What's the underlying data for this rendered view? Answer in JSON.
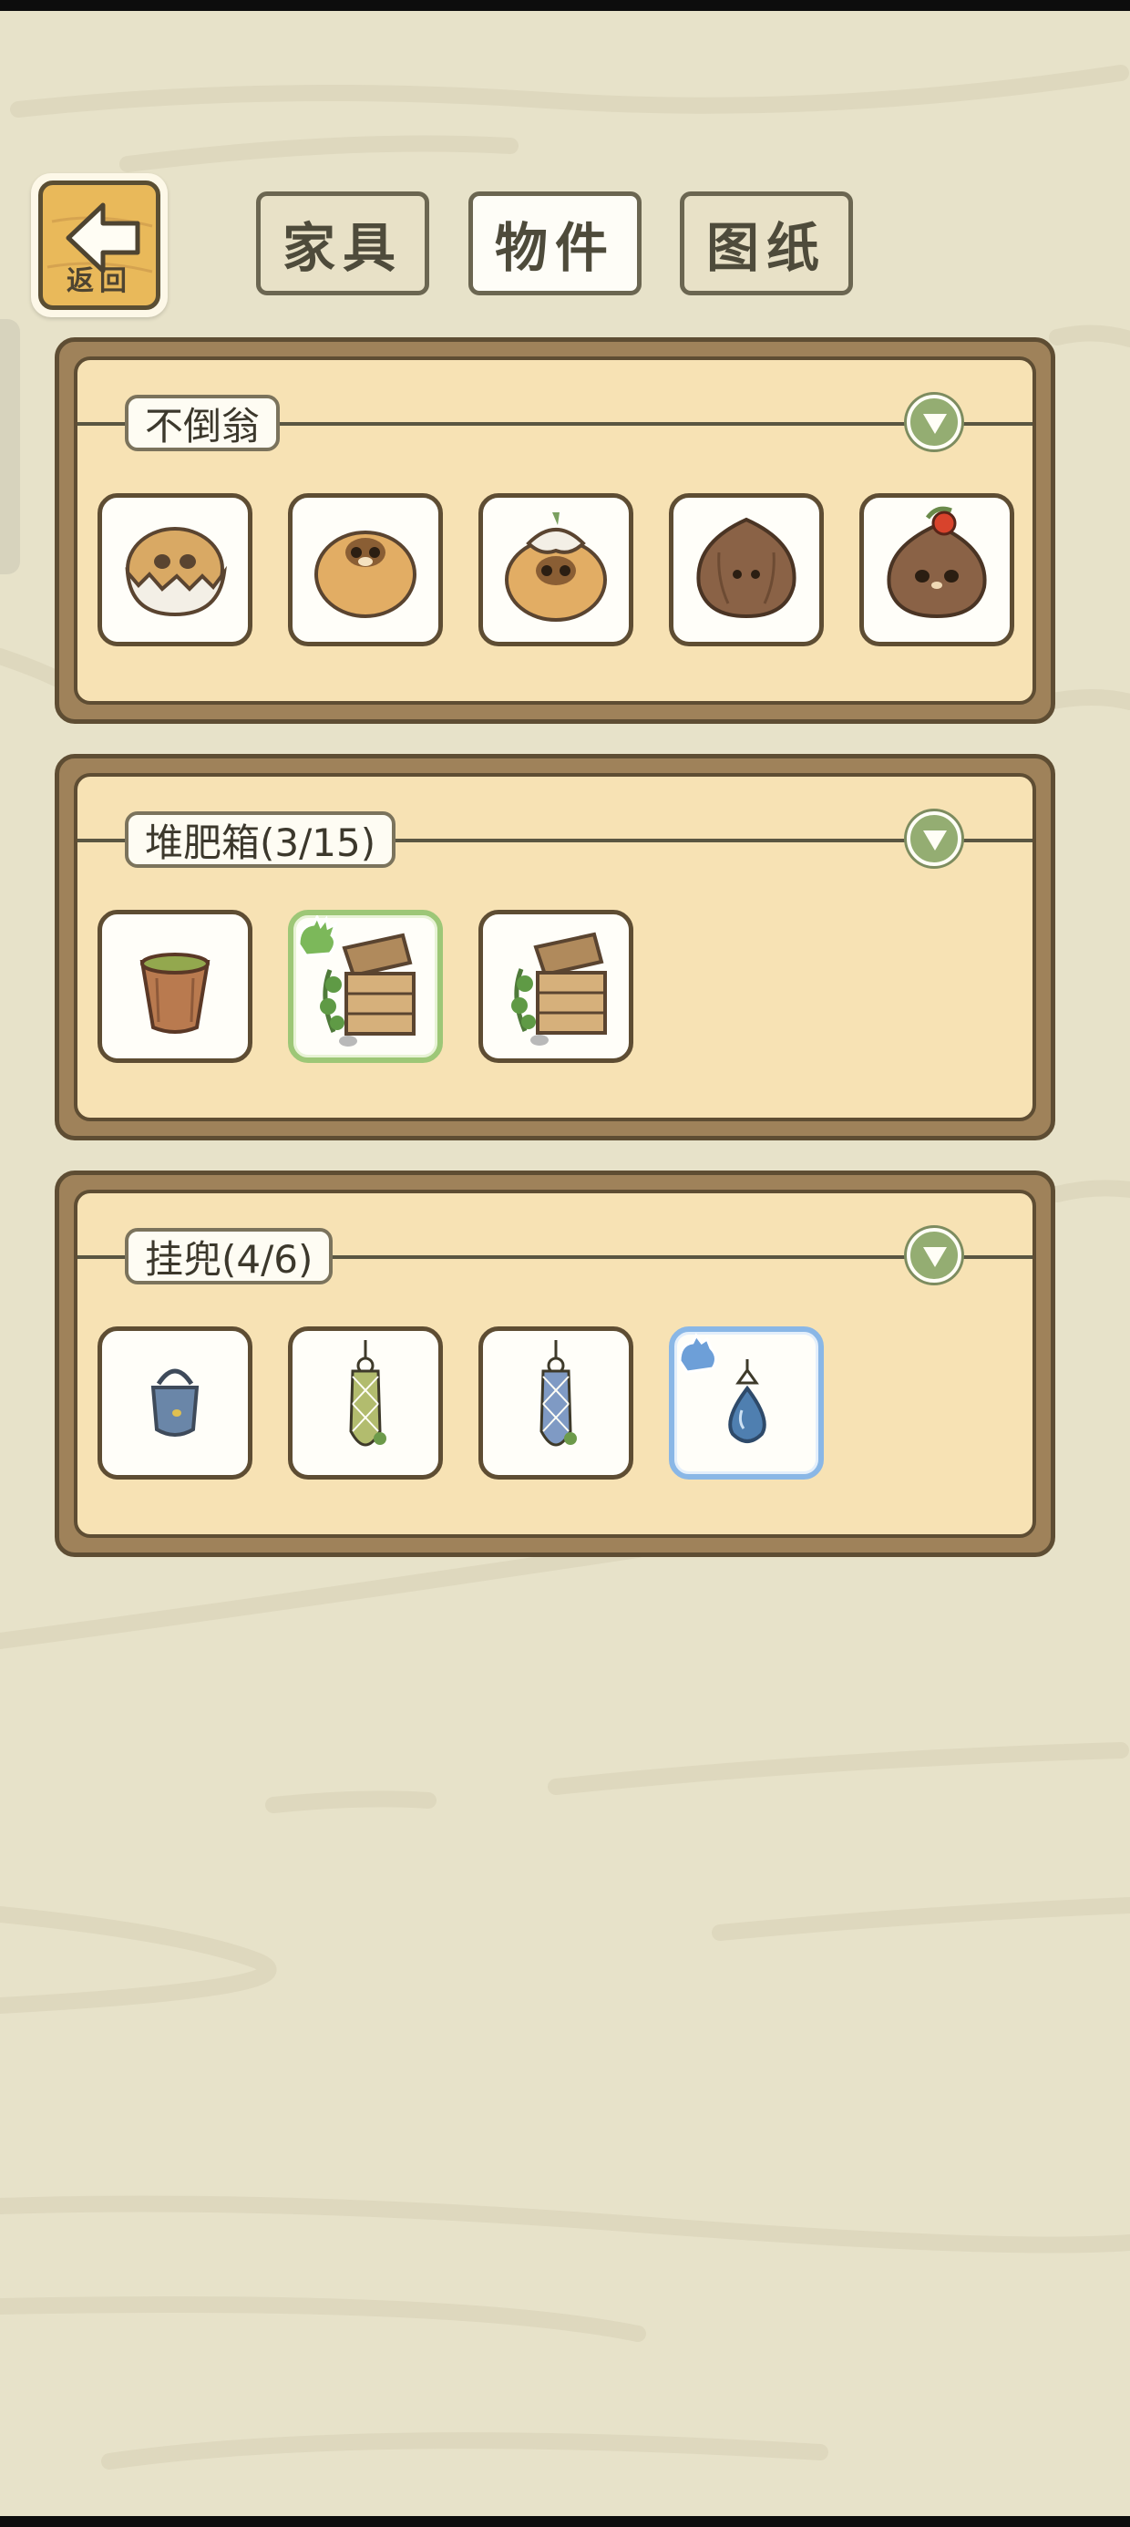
{
  "header": {
    "back_label": "返回",
    "tabs": [
      {
        "label": "家具",
        "active": false
      },
      {
        "label": "物件",
        "active": true
      },
      {
        "label": "图纸",
        "active": false
      }
    ]
  },
  "sections": [
    {
      "title": "不倒翁",
      "items": [
        {
          "icon": "tumbler-eggshell-icon"
        },
        {
          "icon": "tumbler-tanuki-icon"
        },
        {
          "icon": "tumbler-flower-hat-icon"
        },
        {
          "icon": "tumbler-chestnut-icon"
        },
        {
          "icon": "tumbler-cherry-icon"
        }
      ]
    },
    {
      "title": "堆肥箱(3/15)",
      "items": [
        {
          "icon": "compost-bucket-icon"
        },
        {
          "icon": "compost-box-icon",
          "selected": "green"
        },
        {
          "icon": "compost-box-icon"
        }
      ]
    },
    {
      "title": "挂兜(4/6)",
      "items": [
        {
          "icon": "hanging-bag-icon"
        },
        {
          "icon": "hanging-net-green-icon"
        },
        {
          "icon": "hanging-net-blue-icon"
        },
        {
          "icon": "hanging-drop-icon",
          "selected": "blue"
        }
      ]
    }
  ],
  "colors": {
    "background": "#e7e2c9",
    "panel_frame": "#9f825a",
    "panel_fill": "#f7e2b4",
    "select_green": "#9dc777",
    "select_blue": "#8ab7e6",
    "toggle_green": "#94ad72"
  }
}
